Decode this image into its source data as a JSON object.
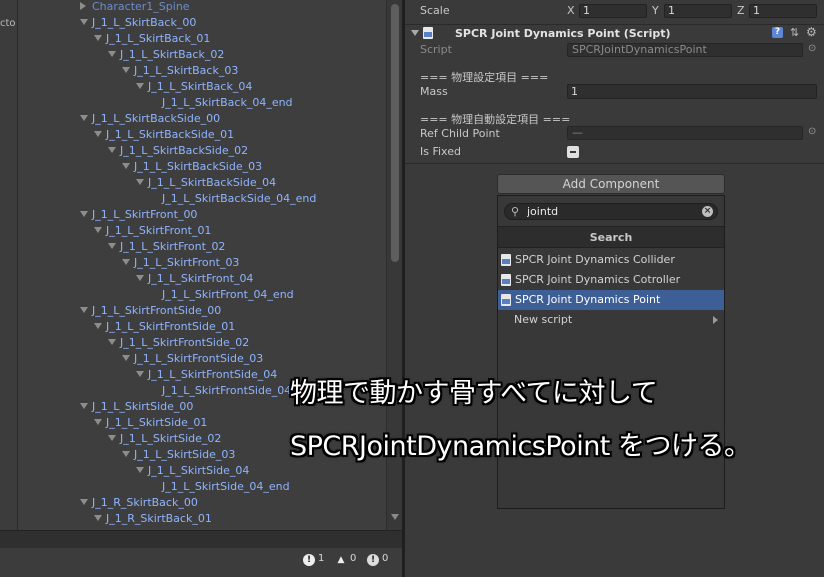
{
  "left_panel": {
    "strip_text": "cto"
  },
  "hierarchy": {
    "items": [
      {
        "label": "Character1_Spine",
        "depth": 4,
        "expanded": false,
        "dim": true
      },
      {
        "label": "J_1_L_SkirtBack_00",
        "depth": 0,
        "expanded": true
      },
      {
        "label": "J_1_L_SkirtBack_01",
        "depth": 1,
        "expanded": true
      },
      {
        "label": "J_1_L_SkirtBack_02",
        "depth": 2,
        "expanded": true
      },
      {
        "label": "J_1_L_SkirtBack_03",
        "depth": 3,
        "expanded": true
      },
      {
        "label": "J_1_L_SkirtBack_04",
        "depth": 4,
        "expanded": true
      },
      {
        "label": "J_1_L_SkirtBack_04_end",
        "depth": 5,
        "leaf": true
      },
      {
        "label": "J_1_L_SkirtBackSide_00",
        "depth": 0,
        "expanded": true
      },
      {
        "label": "J_1_L_SkirtBackSide_01",
        "depth": 1,
        "expanded": true
      },
      {
        "label": "J_1_L_SkirtBackSide_02",
        "depth": 2,
        "expanded": true
      },
      {
        "label": "J_1_L_SkirtBackSide_03",
        "depth": 3,
        "expanded": true
      },
      {
        "label": "J_1_L_SkirtBackSide_04",
        "depth": 4,
        "expanded": true
      },
      {
        "label": "J_1_L_SkirtBackSide_04_end",
        "depth": 5,
        "leaf": true
      },
      {
        "label": "J_1_L_SkirtFront_00",
        "depth": 0,
        "expanded": true
      },
      {
        "label": "J_1_L_SkirtFront_01",
        "depth": 1,
        "expanded": true
      },
      {
        "label": "J_1_L_SkirtFront_02",
        "depth": 2,
        "expanded": true
      },
      {
        "label": "J_1_L_SkirtFront_03",
        "depth": 3,
        "expanded": true
      },
      {
        "label": "J_1_L_SkirtFront_04",
        "depth": 4,
        "expanded": true
      },
      {
        "label": "J_1_L_SkirtFront_04_end",
        "depth": 5,
        "leaf": true
      },
      {
        "label": "J_1_L_SkirtFrontSide_00",
        "depth": 0,
        "expanded": true
      },
      {
        "label": "J_1_L_SkirtFrontSide_01",
        "depth": 1,
        "expanded": true
      },
      {
        "label": "J_1_L_SkirtFrontSide_02",
        "depth": 2,
        "expanded": true
      },
      {
        "label": "J_1_L_SkirtFrontSide_03",
        "depth": 3,
        "expanded": true
      },
      {
        "label": "J_1_L_SkirtFrontSide_04",
        "depth": 4,
        "expanded": true
      },
      {
        "label": "J_1_L_SkirtFrontSide_04_end",
        "depth": 5,
        "leaf": true
      },
      {
        "label": "J_1_L_SkirtSide_00",
        "depth": 0,
        "expanded": true
      },
      {
        "label": "J_1_L_SkirtSide_01",
        "depth": 1,
        "expanded": true
      },
      {
        "label": "J_1_L_SkirtSide_02",
        "depth": 2,
        "expanded": true
      },
      {
        "label": "J_1_L_SkirtSide_03",
        "depth": 3,
        "expanded": true
      },
      {
        "label": "J_1_L_SkirtSide_04",
        "depth": 4,
        "expanded": true
      },
      {
        "label": "J_1_L_SkirtSide_04_end",
        "depth": 5,
        "leaf": true
      },
      {
        "label": "J_1_R_SkirtBack_00",
        "depth": 0,
        "expanded": true
      },
      {
        "label": "J_1_R_SkirtBack_01",
        "depth": 1,
        "expanded": true
      }
    ]
  },
  "console": {
    "menu_glyph": "▾≡",
    "errors": "1",
    "warnings": "0",
    "messages": "0"
  },
  "inspector": {
    "scale": {
      "label": "Scale",
      "x_label": "X",
      "x_value": "1",
      "y_label": "Y",
      "y_value": "1",
      "z_label": "Z",
      "z_value": "1"
    },
    "component": {
      "title": "SPCR Joint Dynamics Point (Script)",
      "help_glyph": "?",
      "settings_glyph": "⇅",
      "gear_glyph": "⚙",
      "script_label": "Script",
      "script_value": "SPCRJointDynamicsPoint",
      "section1": "=== 物理設定項目 ===",
      "mass_label": "Mass",
      "mass_value": "1",
      "section2": "=== 物理自動設定項目 ===",
      "ref_child_label": "Ref Child Point",
      "ref_child_value": "—",
      "is_fixed_label": "Is Fixed",
      "is_fixed": true
    },
    "add_component": {
      "button_label": "Add Component",
      "search_value": "jointd",
      "header": "Search",
      "items": [
        {
          "label": "SPCR Joint Dynamics Collider",
          "selected": false
        },
        {
          "label": "SPCR Joint Dynamics Cotroller",
          "selected": false
        },
        {
          "label": "SPCR Joint Dynamics Point",
          "selected": true
        }
      ],
      "new_script_label": "New script"
    }
  },
  "caption": {
    "line1": "物理で動かす骨すべてに対して",
    "line2": "SPCRJointDynamicsPoint をつける。"
  },
  "colors": {
    "hierarchy_text": "#8fb4ff",
    "selection": "#3e5f96",
    "panel_bg": "#3a3a3a"
  }
}
